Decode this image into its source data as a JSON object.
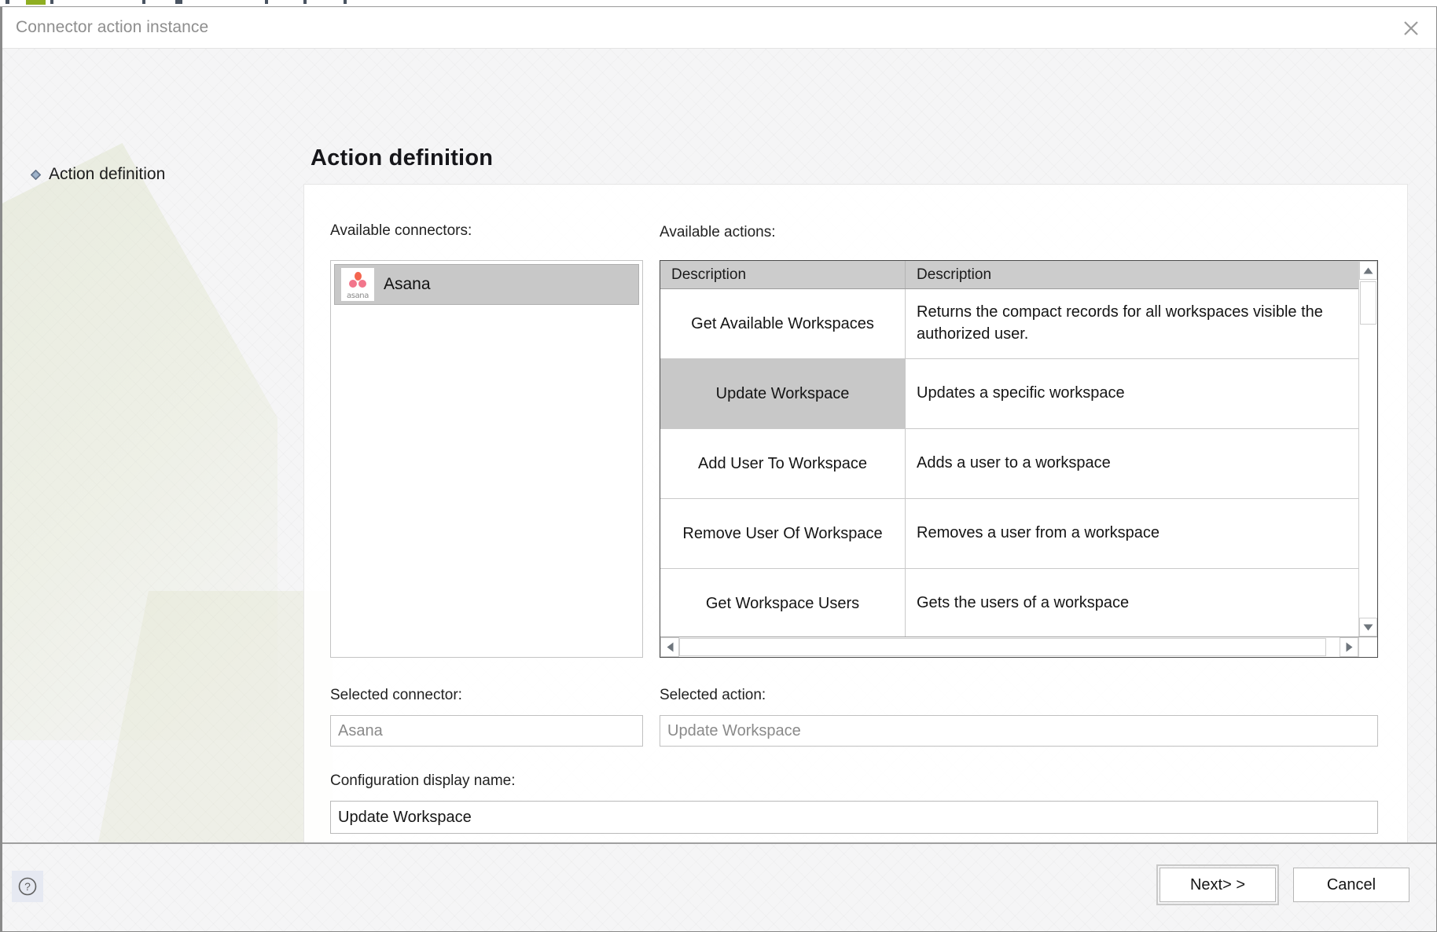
{
  "window": {
    "title": "Connector action instance",
    "close_icon": "close-icon"
  },
  "wizard": {
    "steps": [
      {
        "label": "Action definition",
        "icon": "step-bullet-icon",
        "active": true
      }
    ]
  },
  "page": {
    "heading": "Action definition"
  },
  "connectors": {
    "label": "Available connectors:",
    "items": [
      {
        "name": "Asana",
        "logo_wordmark": "asana",
        "selected": true
      }
    ],
    "selected_label": "Selected connector:",
    "selected_value": "Asana"
  },
  "actions": {
    "label": "Available actions:",
    "columns": [
      "Description",
      "Description"
    ],
    "rows": [
      {
        "name": "Get Available Workspaces",
        "description": "Returns the compact records for all workspaces visible the authorized user.",
        "selected": false
      },
      {
        "name": "Update Workspace",
        "description": "Updates a specific workspace",
        "selected": true
      },
      {
        "name": "Add User To Workspace",
        "description": "Adds a user to a workspace",
        "selected": false
      },
      {
        "name": "Remove User Of Workspace",
        "description": "Removes a user from a workspace",
        "selected": false
      },
      {
        "name": "Get Workspace Users",
        "description": "Gets the users of a workspace",
        "selected": false
      }
    ],
    "selected_label": "Selected action:",
    "selected_value": "Update Workspace",
    "scroll": {
      "up_icon": "scroll-up-arrow-icon",
      "down_icon": "scroll-down-arrow-icon",
      "left_icon": "scroll-left-arrow-icon",
      "right_icon": "scroll-right-arrow-icon"
    }
  },
  "configuration": {
    "display_name_label": "Configuration display name:",
    "display_name_value": "Update Workspace"
  },
  "footer": {
    "help_icon": "help-question-icon",
    "next_label": "Next> >",
    "cancel_label": "Cancel"
  },
  "colors": {
    "accent_green": "#8fae22",
    "asana_coral": "#f06a6a",
    "selection_gray": "#c8c8c8",
    "header_gray": "#cccccc"
  }
}
